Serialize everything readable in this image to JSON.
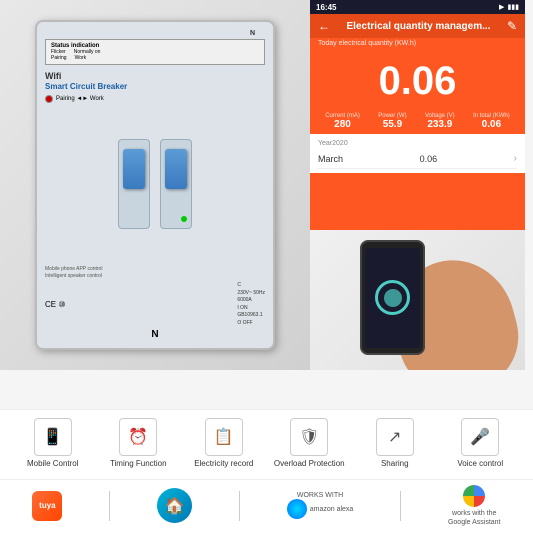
{
  "product": {
    "name": "Wifi Smart Circuit Breaker",
    "status_indication": {
      "title": "Status indication",
      "flicker": "Flicker",
      "normally_on": "Normally on",
      "pairing": "Pairing",
      "work": "Work"
    },
    "wifi_label": "Wifi",
    "smart_label": "Smart Circuit Breaker",
    "pairing_work": "Pairing ◄► Work",
    "terminal_n_label": "N",
    "specs": {
      "voltage": "230V~",
      "frequency": "50Hz",
      "current": "6000A",
      "standard": "GB10963.1",
      "on": "I ON",
      "off": "O OFF",
      "rating": "C"
    },
    "mobile_control": "Mobile phone APP control",
    "speaker_control": "Intelligent speaker control"
  },
  "app": {
    "status_bar": {
      "time": "16:45",
      "battery": "▮▮▮"
    },
    "title": "Electrical quantity managem...",
    "subtitle": "Today electrical quantity (KW.h)",
    "big_value": "0.06",
    "stats": [
      {
        "label": "Current (mA)",
        "value": "280"
      },
      {
        "label": "Power (W)",
        "value": "55.9"
      },
      {
        "label": "Voltage (V)",
        "value": "233.9"
      },
      {
        "label": "In total (KWh)",
        "value": "0.06"
      }
    ],
    "year_label": "Year2020",
    "month_row": {
      "label": "March",
      "value": "0.06"
    }
  },
  "features": [
    {
      "icon": "📱",
      "label": "Mobile\nControl"
    },
    {
      "icon": "⏰",
      "label": "Timing\nFunction"
    },
    {
      "icon": "📋",
      "label": "Electricity\nrecord"
    },
    {
      "icon": "🛡",
      "label": "Overload\nProtection"
    },
    {
      "icon": "↗",
      "label": "Sharing"
    },
    {
      "icon": "🎤",
      "label": "Voice control"
    }
  ],
  "brands": {
    "tuya": "tuya",
    "smart_home_label": "🏠",
    "alexa_works_with": "WORKS WITH",
    "alexa_name": "amazon alexa",
    "google_works_with": "works with the",
    "google_name": "Google Assistant"
  }
}
